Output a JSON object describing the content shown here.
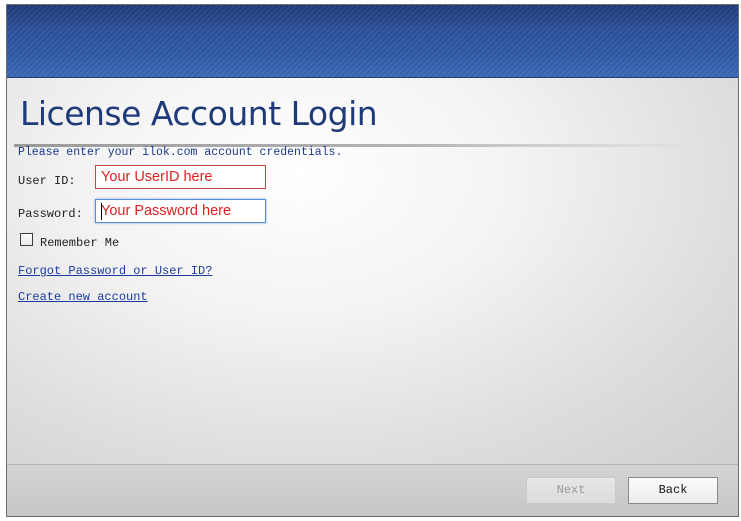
{
  "login": {
    "title": "License Account Login",
    "instruction": "Please enter your ilok.com account credentials.",
    "userid_label": "User ID:",
    "userid_placeholder": "Your UserID here",
    "password_label": "Password:",
    "password_placeholder": "Your Password here",
    "remember_label": "Remember Me",
    "remember_checked": false,
    "forgot_link": "Forgot Password or User ID?",
    "create_link": "Create new account"
  },
  "footer": {
    "next_label": "Next",
    "next_enabled": false,
    "back_label": "Back"
  },
  "colors": {
    "header": "#2b4f99",
    "title": "#1e3a79",
    "placeholder": "#e02020",
    "link": "#1a3aa0"
  }
}
